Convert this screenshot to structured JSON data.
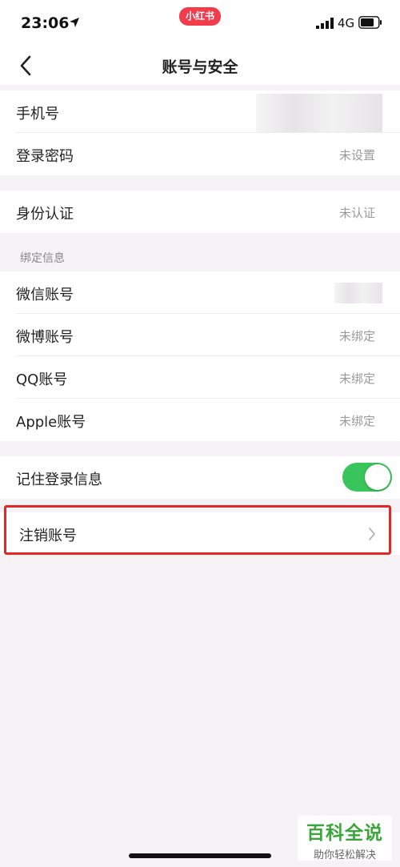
{
  "status_bar": {
    "time": "23:06",
    "app_badge": "小红书",
    "network": "4G",
    "icons": [
      "location-arrow-icon",
      "signal-icon",
      "battery-icon"
    ]
  },
  "nav": {
    "title": "账号与安全",
    "back_icon": "chevron-left-icon"
  },
  "account": {
    "phone_label": "手机号",
    "password_label": "登录密码",
    "password_value": "未设置"
  },
  "identity": {
    "label": "身份认证",
    "value": "未认证"
  },
  "binding": {
    "header": "绑定信息",
    "wechat_label": "微信账号",
    "weibo_label": "微博账号",
    "weibo_value": "未绑定",
    "qq_label": "QQ账号",
    "qq_value": "未绑定",
    "apple_label": "Apple账号",
    "apple_value": "未绑定"
  },
  "remember": {
    "label": "记住登录信息",
    "enabled": true,
    "toggle_color": "#3ac45c"
  },
  "cancel_account": {
    "label": "注销账号",
    "highlight_color": "#e02a2a"
  },
  "watermark": {
    "title": "百科全说",
    "subtitle": "助你轻松解决"
  }
}
